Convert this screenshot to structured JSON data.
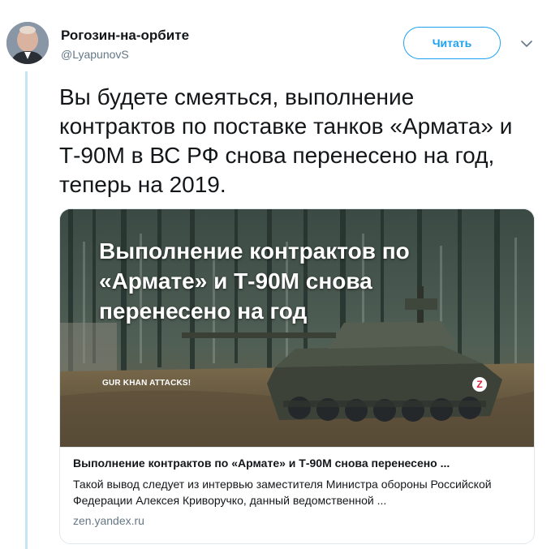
{
  "tweet": {
    "author": {
      "name": "Рогозин-на-орбите",
      "handle": "@LyapunovS"
    },
    "follow_label": "Читать",
    "text": "Вы будете смеяться, выполнение контрактов по поставке танков «Армата» и Т-90М в ВС РФ снова перенесено на год, теперь на 2019."
  },
  "card": {
    "image": {
      "headline": "Выполнение контрактов по «Армате» и Т-90М снова перенесено на год",
      "watermark": "GUR KHAN ATTACKS!",
      "badge": "Z"
    },
    "title": "Выполнение контрактов по «Армате» и Т-90М снова перенесено ...",
    "description": "Такой вывод следует из интервью заместителя Министра обороны Российской Федерации Алексея Криворучко, данный ведомственной ...",
    "domain": "zen.yandex.ru"
  },
  "icons": {
    "caret": "chevron-down-icon",
    "avatar": "profile-photo"
  },
  "colors": {
    "accent": "#1da1f2",
    "thread_line": "#c4e4f7",
    "secondary_text": "#657786",
    "border": "#e1e8ed"
  }
}
